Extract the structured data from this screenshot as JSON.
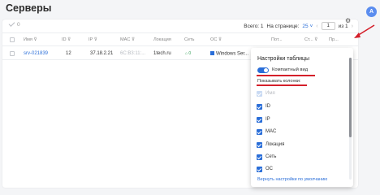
{
  "page": {
    "title": "Серверы",
    "avatar_letter": "A"
  },
  "toolbar": {
    "selected_count": "0",
    "total_label": "Всего: 1",
    "per_page_label": "На странице:",
    "per_page_value": "25",
    "prev": "‹",
    "page_value": "1",
    "of_pages": "из 1",
    "next": "›"
  },
  "table": {
    "columns": [
      "Имя",
      "ID",
      "IP",
      "MAC",
      "Локация",
      "Сеть",
      "ОС",
      "Пот...",
      "Ст...",
      "Пр..."
    ],
    "row": {
      "name": "srv-021839",
      "id": "12",
      "ip": "37.18.2.21",
      "mac": "6C:B3:11:...",
      "location": "1tech.ru",
      "net": "⌂ 0",
      "os": "Windows Ser..."
    }
  },
  "settings_popup": {
    "title": "Настройки таблицы",
    "compact_label": "Компактный вид",
    "compact_on": true,
    "columns_header": "Показывать колонки:",
    "columns": [
      {
        "label": "Имя",
        "checked": true,
        "disabled": true
      },
      {
        "label": "ID",
        "checked": true,
        "disabled": false
      },
      {
        "label": "IP",
        "checked": true,
        "disabled": false
      },
      {
        "label": "MAC",
        "checked": true,
        "disabled": false
      },
      {
        "label": "Локация",
        "checked": true,
        "disabled": false
      },
      {
        "label": "Сеть",
        "checked": true,
        "disabled": false
      },
      {
        "label": "ОС",
        "checked": true,
        "disabled": false
      }
    ],
    "reset_label": "Вернуть настройки по умолчанию"
  },
  "colors": {
    "accent": "#2a6ed8",
    "annotation": "#d41f2a"
  }
}
